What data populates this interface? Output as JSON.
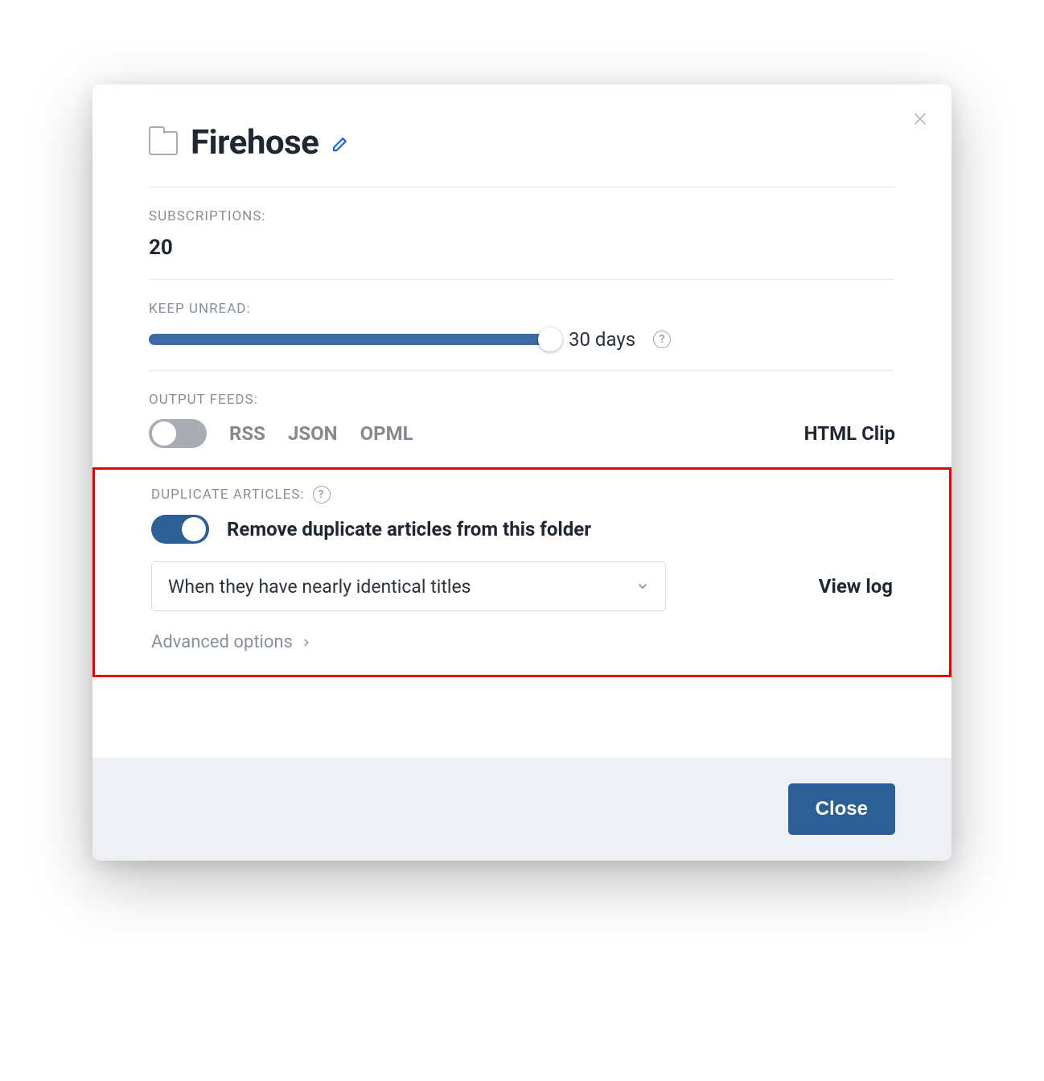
{
  "modal": {
    "title": "Firehose",
    "close_x": "×",
    "subscriptions": {
      "label": "Subscriptions:",
      "value": "20"
    },
    "keep_unread": {
      "label": "Keep unread:",
      "value": "30 days"
    },
    "output_feeds": {
      "label": "Output feeds:",
      "rss": "RSS",
      "json": "JSON",
      "opml": "OPML",
      "html_clip": "HTML Clip"
    },
    "duplicates": {
      "label": "Duplicate articles:",
      "toggle_label": "Remove duplicate articles from this folder",
      "select_value": "When they have nearly identical titles",
      "view_log": "View log",
      "advanced": "Advanced options"
    },
    "footer": {
      "close": "Close"
    }
  }
}
